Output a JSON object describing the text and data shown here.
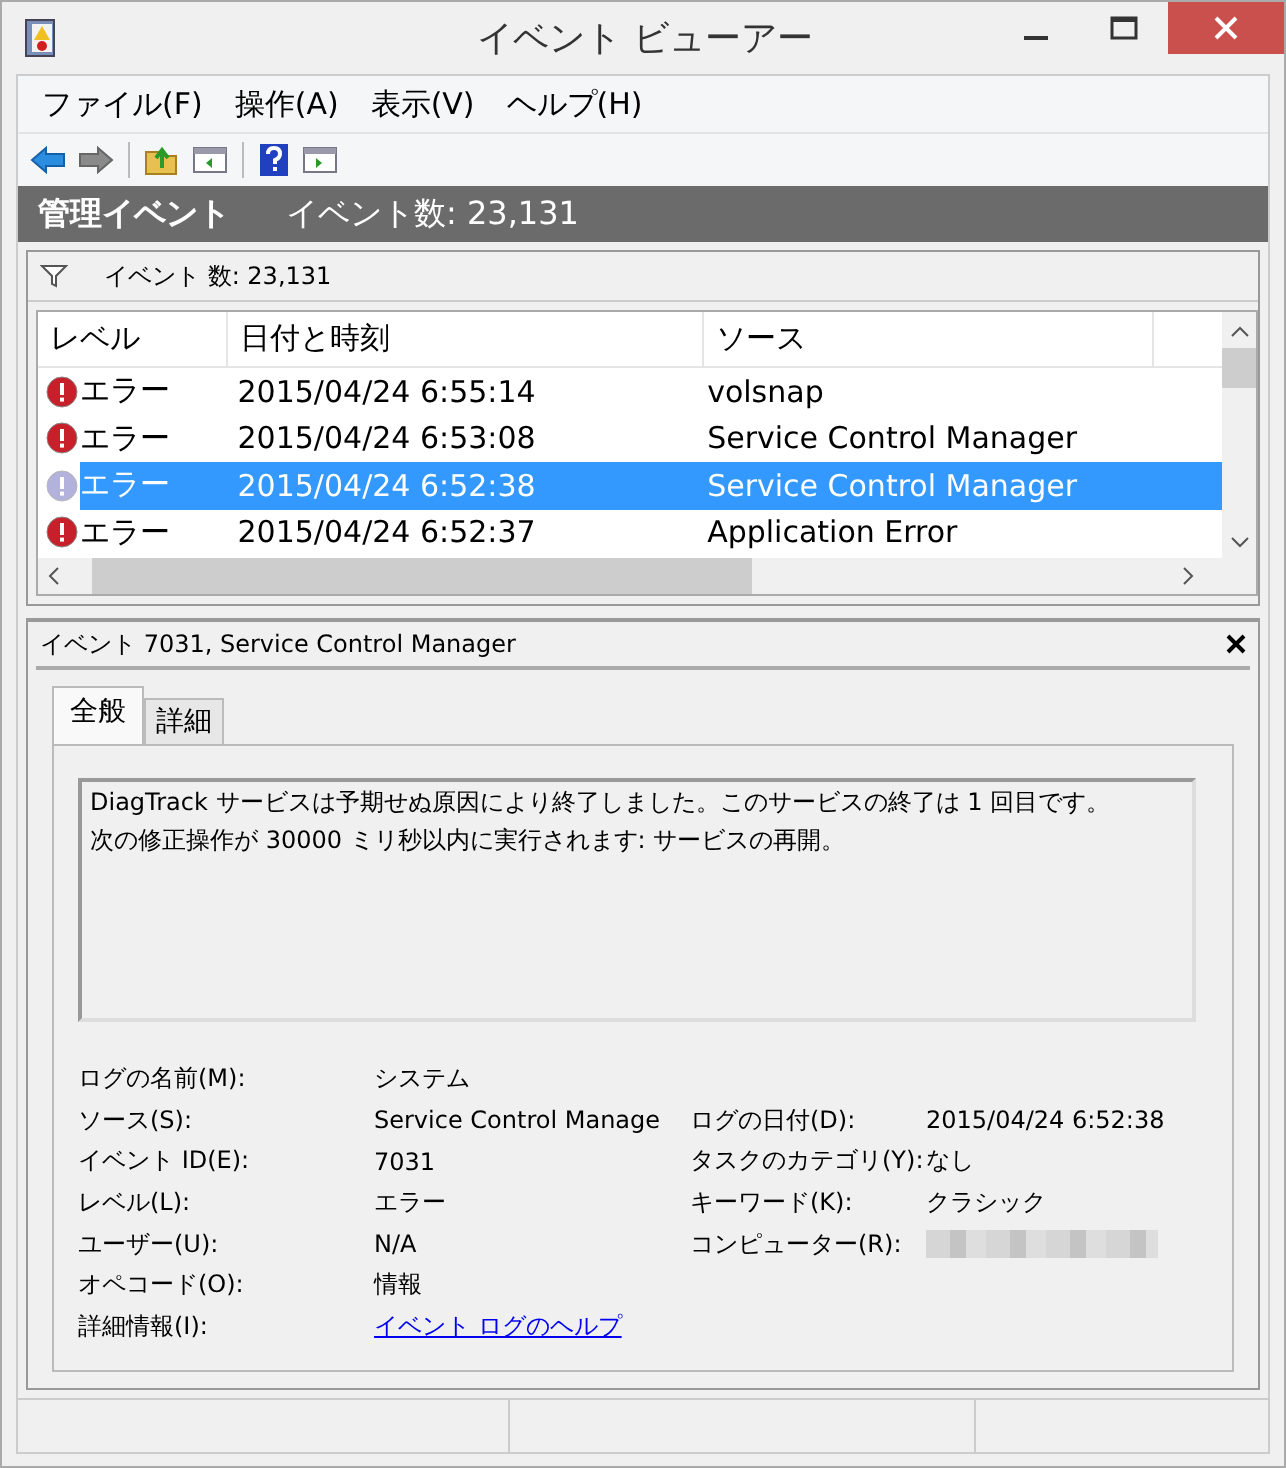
{
  "window": {
    "title": "イベント ビューアー"
  },
  "menu": [
    "ファイル(F)",
    "操作(A)",
    "表示(V)",
    "ヘルプ(H)"
  ],
  "header": {
    "title": "管理イベント",
    "count": "イベント数: 23,131"
  },
  "filter": {
    "text": "イベント 数: 23,131"
  },
  "table": {
    "columns": [
      "レベル",
      "日付と時刻",
      "ソース"
    ],
    "rows": [
      {
        "level": "エラー",
        "date": "2015/04/24 6:55:14",
        "source": "volsnap",
        "selected": false
      },
      {
        "level": "エラー",
        "date": "2015/04/24 6:53:08",
        "source": "Service Control Manager",
        "selected": false
      },
      {
        "level": "エラー",
        "date": "2015/04/24 6:52:38",
        "source": "Service Control Manager",
        "selected": true
      },
      {
        "level": "エラー",
        "date": "2015/04/24 6:52:37",
        "source": "Application Error",
        "selected": false
      }
    ]
  },
  "detail": {
    "title": "イベント 7031, Service Control Manager",
    "tabs": [
      {
        "label": "全般",
        "selected": true
      },
      {
        "label": "詳細",
        "selected": false
      }
    ],
    "message": [
      "DiagTrack サービスは予期せぬ原因により終了しました。このサービスの終了は 1 回目です。",
      "次の修正操作が 30000 ミリ秒以内に実行されます: サービスの再開。"
    ],
    "left": [
      {
        "label": "ログの名前(M):",
        "value": "システム",
        "kind": "text"
      },
      {
        "label": "ソース(S):",
        "value": "Service Control Manage",
        "kind": "text"
      },
      {
        "label": "イベント ID(E):",
        "value": "7031",
        "kind": "text"
      },
      {
        "label": "レベル(L):",
        "value": "エラー",
        "kind": "text"
      },
      {
        "label": "ユーザー(U):",
        "value": "N/A",
        "kind": "text"
      },
      {
        "label": "オペコード(O):",
        "value": "情報",
        "kind": "text"
      },
      {
        "label": "詳細情報(I):",
        "value": "イベント ログのヘルプ",
        "kind": "link"
      }
    ],
    "right": [
      {
        "label": "ログの日付(D):",
        "value": "2015/04/24 6:52:38",
        "kind": "text"
      },
      {
        "label": "タスクのカテゴリ(Y):",
        "value": "なし",
        "kind": "text"
      },
      {
        "label": "キーワード(K):",
        "value": "クラシック",
        "kind": "text"
      },
      {
        "label": "コンピューター(R):",
        "kind": "redacted"
      }
    ]
  }
}
